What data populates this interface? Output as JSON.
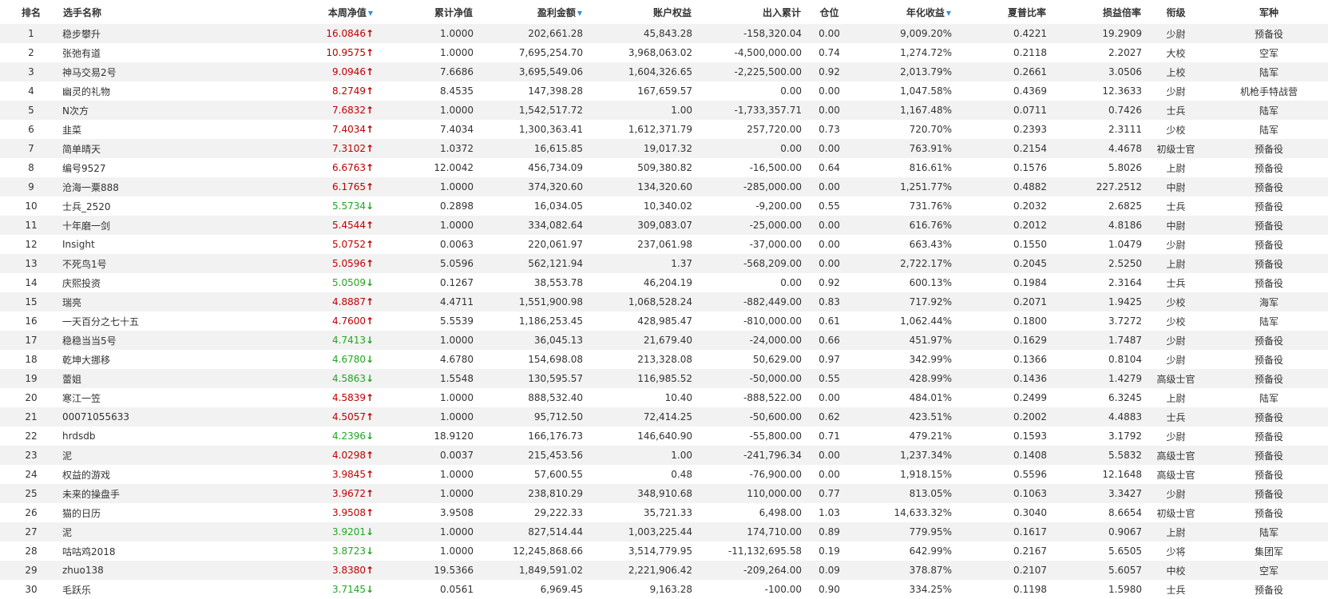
{
  "headers": {
    "rank": "排名",
    "name": "选手名称",
    "nav": "本周净值",
    "cum_nav": "累计净值",
    "profit": "盈利金额",
    "equity": "账户权益",
    "inout": "出入累计",
    "position": "仓位",
    "annual": "年化收益",
    "sharpe": "夏普比率",
    "pl_ratio": "损益倍率",
    "grade": "衔级",
    "branch": "军种",
    "sort_glyph": "▼"
  },
  "colors": {
    "up": "#c00000",
    "down": "#22a622",
    "sort": "#3a8fd6",
    "stripe": "#f2f2f2"
  },
  "rows": [
    {
      "rank": "1",
      "name": "稳步攀升",
      "nav": "16.0846",
      "dir": "up",
      "cum_nav": "1.0000",
      "profit": "202,661.28",
      "equity": "45,843.28",
      "inout": "-158,320.04",
      "position": "0.00",
      "annual": "9,009.20%",
      "sharpe": "0.4221",
      "pl_ratio": "19.2909",
      "grade": "少尉",
      "branch": "预备役"
    },
    {
      "rank": "2",
      "name": "张弛有道",
      "nav": "10.9575",
      "dir": "up",
      "cum_nav": "1.0000",
      "profit": "7,695,254.70",
      "equity": "3,968,063.02",
      "inout": "-4,500,000.00",
      "position": "0.74",
      "annual": "1,274.72%",
      "sharpe": "0.2118",
      "pl_ratio": "2.2027",
      "grade": "大校",
      "branch": "空军"
    },
    {
      "rank": "3",
      "name": "神马交易2号",
      "nav": "9.0946",
      "dir": "up",
      "cum_nav": "7.6686",
      "profit": "3,695,549.06",
      "equity": "1,604,326.65",
      "inout": "-2,225,500.00",
      "position": "0.92",
      "annual": "2,013.79%",
      "sharpe": "0.2661",
      "pl_ratio": "3.0506",
      "grade": "上校",
      "branch": "陆军"
    },
    {
      "rank": "4",
      "name": "幽灵的礼物",
      "nav": "8.2749",
      "dir": "up",
      "cum_nav": "8.4535",
      "profit": "147,398.28",
      "equity": "167,659.57",
      "inout": "0.00",
      "position": "0.00",
      "annual": "1,047.58%",
      "sharpe": "0.4369",
      "pl_ratio": "12.3633",
      "grade": "少尉",
      "branch": "机枪手特战营"
    },
    {
      "rank": "5",
      "name": "N次方",
      "nav": "7.6832",
      "dir": "up",
      "cum_nav": "1.0000",
      "profit": "1,542,517.72",
      "equity": "1.00",
      "inout": "-1,733,357.71",
      "position": "0.00",
      "annual": "1,167.48%",
      "sharpe": "0.0711",
      "pl_ratio": "0.7426",
      "grade": "士兵",
      "branch": "陆军"
    },
    {
      "rank": "6",
      "name": "韭菜",
      "nav": "7.4034",
      "dir": "up",
      "cum_nav": "7.4034",
      "profit": "1,300,363.41",
      "equity": "1,612,371.79",
      "inout": "257,720.00",
      "position": "0.73",
      "annual": "720.70%",
      "sharpe": "0.2393",
      "pl_ratio": "2.3111",
      "grade": "少校",
      "branch": "陆军"
    },
    {
      "rank": "7",
      "name": "简单晴天",
      "nav": "7.3102",
      "dir": "up",
      "cum_nav": "1.0372",
      "profit": "16,615.85",
      "equity": "19,017.32",
      "inout": "0.00",
      "position": "0.00",
      "annual": "763.91%",
      "sharpe": "0.2154",
      "pl_ratio": "4.4678",
      "grade": "初级士官",
      "branch": "预备役"
    },
    {
      "rank": "8",
      "name": "编号9527",
      "nav": "6.6763",
      "dir": "up",
      "cum_nav": "12.0042",
      "profit": "456,734.09",
      "equity": "509,380.82",
      "inout": "-16,500.00",
      "position": "0.64",
      "annual": "816.61%",
      "sharpe": "0.1576",
      "pl_ratio": "5.8026",
      "grade": "上尉",
      "branch": "预备役"
    },
    {
      "rank": "9",
      "name": "沧海一粟888",
      "nav": "6.1765",
      "dir": "up",
      "cum_nav": "1.0000",
      "profit": "374,320.60",
      "equity": "134,320.60",
      "inout": "-285,000.00",
      "position": "0.00",
      "annual": "1,251.77%",
      "sharpe": "0.4882",
      "pl_ratio": "227.2512",
      "grade": "中尉",
      "branch": "预备役"
    },
    {
      "rank": "10",
      "name": "士兵_2520",
      "nav": "5.5734",
      "dir": "down",
      "cum_nav": "0.2898",
      "profit": "16,034.05",
      "equity": "10,340.02",
      "inout": "-9,200.00",
      "position": "0.55",
      "annual": "731.76%",
      "sharpe": "0.2032",
      "pl_ratio": "2.6825",
      "grade": "士兵",
      "branch": "预备役"
    },
    {
      "rank": "11",
      "name": "十年磨一剑",
      "nav": "5.4544",
      "dir": "up",
      "cum_nav": "1.0000",
      "profit": "334,082.64",
      "equity": "309,083.07",
      "inout": "-25,000.00",
      "position": "0.00",
      "annual": "616.76%",
      "sharpe": "0.2012",
      "pl_ratio": "4.8186",
      "grade": "中尉",
      "branch": "预备役"
    },
    {
      "rank": "12",
      "name": "Insight",
      "nav": "5.0752",
      "dir": "up",
      "cum_nav": "0.0063",
      "profit": "220,061.97",
      "equity": "237,061.98",
      "inout": "-37,000.00",
      "position": "0.00",
      "annual": "663.43%",
      "sharpe": "0.1550",
      "pl_ratio": "1.0479",
      "grade": "少尉",
      "branch": "预备役"
    },
    {
      "rank": "13",
      "name": "不死鸟1号",
      "nav": "5.0596",
      "dir": "up",
      "cum_nav": "5.0596",
      "profit": "562,121.94",
      "equity": "1.37",
      "inout": "-568,209.00",
      "position": "0.00",
      "annual": "2,722.17%",
      "sharpe": "0.2045",
      "pl_ratio": "2.5250",
      "grade": "上尉",
      "branch": "预备役"
    },
    {
      "rank": "14",
      "name": "庆熙投资",
      "nav": "5.0509",
      "dir": "down",
      "cum_nav": "0.1267",
      "profit": "38,553.78",
      "equity": "46,204.19",
      "inout": "0.00",
      "position": "0.92",
      "annual": "600.13%",
      "sharpe": "0.1984",
      "pl_ratio": "2.3164",
      "grade": "士兵",
      "branch": "预备役"
    },
    {
      "rank": "15",
      "name": "瑞亮",
      "nav": "4.8887",
      "dir": "up",
      "cum_nav": "4.4711",
      "profit": "1,551,900.98",
      "equity": "1,068,528.24",
      "inout": "-882,449.00",
      "position": "0.83",
      "annual": "717.92%",
      "sharpe": "0.2071",
      "pl_ratio": "1.9425",
      "grade": "少校",
      "branch": "海军"
    },
    {
      "rank": "16",
      "name": "一天百分之七十五",
      "nav": "4.7600",
      "dir": "up",
      "cum_nav": "5.5539",
      "profit": "1,186,253.45",
      "equity": "428,985.47",
      "inout": "-810,000.00",
      "position": "0.61",
      "annual": "1,062.44%",
      "sharpe": "0.1800",
      "pl_ratio": "3.7272",
      "grade": "少校",
      "branch": "陆军"
    },
    {
      "rank": "17",
      "name": "稳稳当当5号",
      "nav": "4.7413",
      "dir": "down",
      "cum_nav": "1.0000",
      "profit": "36,045.13",
      "equity": "21,679.40",
      "inout": "-24,000.00",
      "position": "0.66",
      "annual": "451.97%",
      "sharpe": "0.1629",
      "pl_ratio": "1.7487",
      "grade": "少尉",
      "branch": "预备役"
    },
    {
      "rank": "18",
      "name": "乾坤大挪移",
      "nav": "4.6780",
      "dir": "down",
      "cum_nav": "4.6780",
      "profit": "154,698.08",
      "equity": "213,328.08",
      "inout": "50,629.00",
      "position": "0.97",
      "annual": "342.99%",
      "sharpe": "0.1366",
      "pl_ratio": "0.8104",
      "grade": "少尉",
      "branch": "预备役"
    },
    {
      "rank": "19",
      "name": "蕾姐",
      "nav": "4.5863",
      "dir": "down",
      "cum_nav": "1.5548",
      "profit": "130,595.57",
      "equity": "116,985.52",
      "inout": "-50,000.00",
      "position": "0.55",
      "annual": "428.99%",
      "sharpe": "0.1436",
      "pl_ratio": "1.4279",
      "grade": "高级士官",
      "branch": "预备役"
    },
    {
      "rank": "20",
      "name": "寒江一笠",
      "nav": "4.5839",
      "dir": "up",
      "cum_nav": "1.0000",
      "profit": "888,532.40",
      "equity": "10.40",
      "inout": "-888,522.00",
      "position": "0.00",
      "annual": "484.01%",
      "sharpe": "0.2499",
      "pl_ratio": "6.3245",
      "grade": "上尉",
      "branch": "陆军"
    },
    {
      "rank": "21",
      "name": "00071055633",
      "nav": "4.5057",
      "dir": "up",
      "cum_nav": "1.0000",
      "profit": "95,712.50",
      "equity": "72,414.25",
      "inout": "-50,600.00",
      "position": "0.62",
      "annual": "423.51%",
      "sharpe": "0.2002",
      "pl_ratio": "4.4883",
      "grade": "士兵",
      "branch": "预备役"
    },
    {
      "rank": "22",
      "name": "hrdsdb",
      "nav": "4.2396",
      "dir": "down",
      "cum_nav": "18.9120",
      "profit": "166,176.73",
      "equity": "146,640.90",
      "inout": "-55,800.00",
      "position": "0.71",
      "annual": "479.21%",
      "sharpe": "0.1593",
      "pl_ratio": "3.1792",
      "grade": "少尉",
      "branch": "预备役"
    },
    {
      "rank": "23",
      "name": "泥",
      "nav": "4.0298",
      "dir": "up",
      "cum_nav": "0.0037",
      "profit": "215,453.56",
      "equity": "1.00",
      "inout": "-241,796.34",
      "position": "0.00",
      "annual": "1,237.34%",
      "sharpe": "0.1408",
      "pl_ratio": "5.5832",
      "grade": "高级士官",
      "branch": "预备役"
    },
    {
      "rank": "24",
      "name": "权益的游戏",
      "nav": "3.9845",
      "dir": "up",
      "cum_nav": "1.0000",
      "profit": "57,600.55",
      "equity": "0.48",
      "inout": "-76,900.00",
      "position": "0.00",
      "annual": "1,918.15%",
      "sharpe": "0.5596",
      "pl_ratio": "12.1648",
      "grade": "高级士官",
      "branch": "预备役"
    },
    {
      "rank": "25",
      "name": "未来的操盘手",
      "nav": "3.9672",
      "dir": "up",
      "cum_nav": "1.0000",
      "profit": "238,810.29",
      "equity": "348,910.68",
      "inout": "110,000.00",
      "position": "0.77",
      "annual": "813.05%",
      "sharpe": "0.1063",
      "pl_ratio": "3.3427",
      "grade": "少尉",
      "branch": "预备役"
    },
    {
      "rank": "26",
      "name": "猫的日历",
      "nav": "3.9508",
      "dir": "up",
      "cum_nav": "3.9508",
      "profit": "29,222.33",
      "equity": "35,721.33",
      "inout": "6,498.00",
      "position": "1.03",
      "annual": "14,633.32%",
      "sharpe": "0.3040",
      "pl_ratio": "8.6654",
      "grade": "初级士官",
      "branch": "预备役"
    },
    {
      "rank": "27",
      "name": "泥",
      "nav": "3.9201",
      "dir": "down",
      "cum_nav": "1.0000",
      "profit": "827,514.44",
      "equity": "1,003,225.44",
      "inout": "174,710.00",
      "position": "0.89",
      "annual": "779.95%",
      "sharpe": "0.1617",
      "pl_ratio": "0.9067",
      "grade": "上尉",
      "branch": "陆军"
    },
    {
      "rank": "28",
      "name": "咕咕鸡2018",
      "nav": "3.8723",
      "dir": "down",
      "cum_nav": "1.0000",
      "profit": "12,245,868.66",
      "equity": "3,514,779.95",
      "inout": "-11,132,695.58",
      "position": "0.19",
      "annual": "642.99%",
      "sharpe": "0.2167",
      "pl_ratio": "5.6505",
      "grade": "少将",
      "branch": "集团军"
    },
    {
      "rank": "29",
      "name": "zhuo138",
      "nav": "3.8380",
      "dir": "up",
      "cum_nav": "19.5366",
      "profit": "1,849,591.02",
      "equity": "2,221,906.42",
      "inout": "-209,264.00",
      "position": "0.09",
      "annual": "378.87%",
      "sharpe": "0.2107",
      "pl_ratio": "5.6057",
      "grade": "中校",
      "branch": "空军"
    },
    {
      "rank": "30",
      "name": "毛跃乐",
      "nav": "3.7145",
      "dir": "down",
      "cum_nav": "0.0561",
      "profit": "6,969.45",
      "equity": "9,163.28",
      "inout": "-100.00",
      "position": "0.90",
      "annual": "334.25%",
      "sharpe": "0.1198",
      "pl_ratio": "1.5980",
      "grade": "士兵",
      "branch": "预备役"
    }
  ]
}
